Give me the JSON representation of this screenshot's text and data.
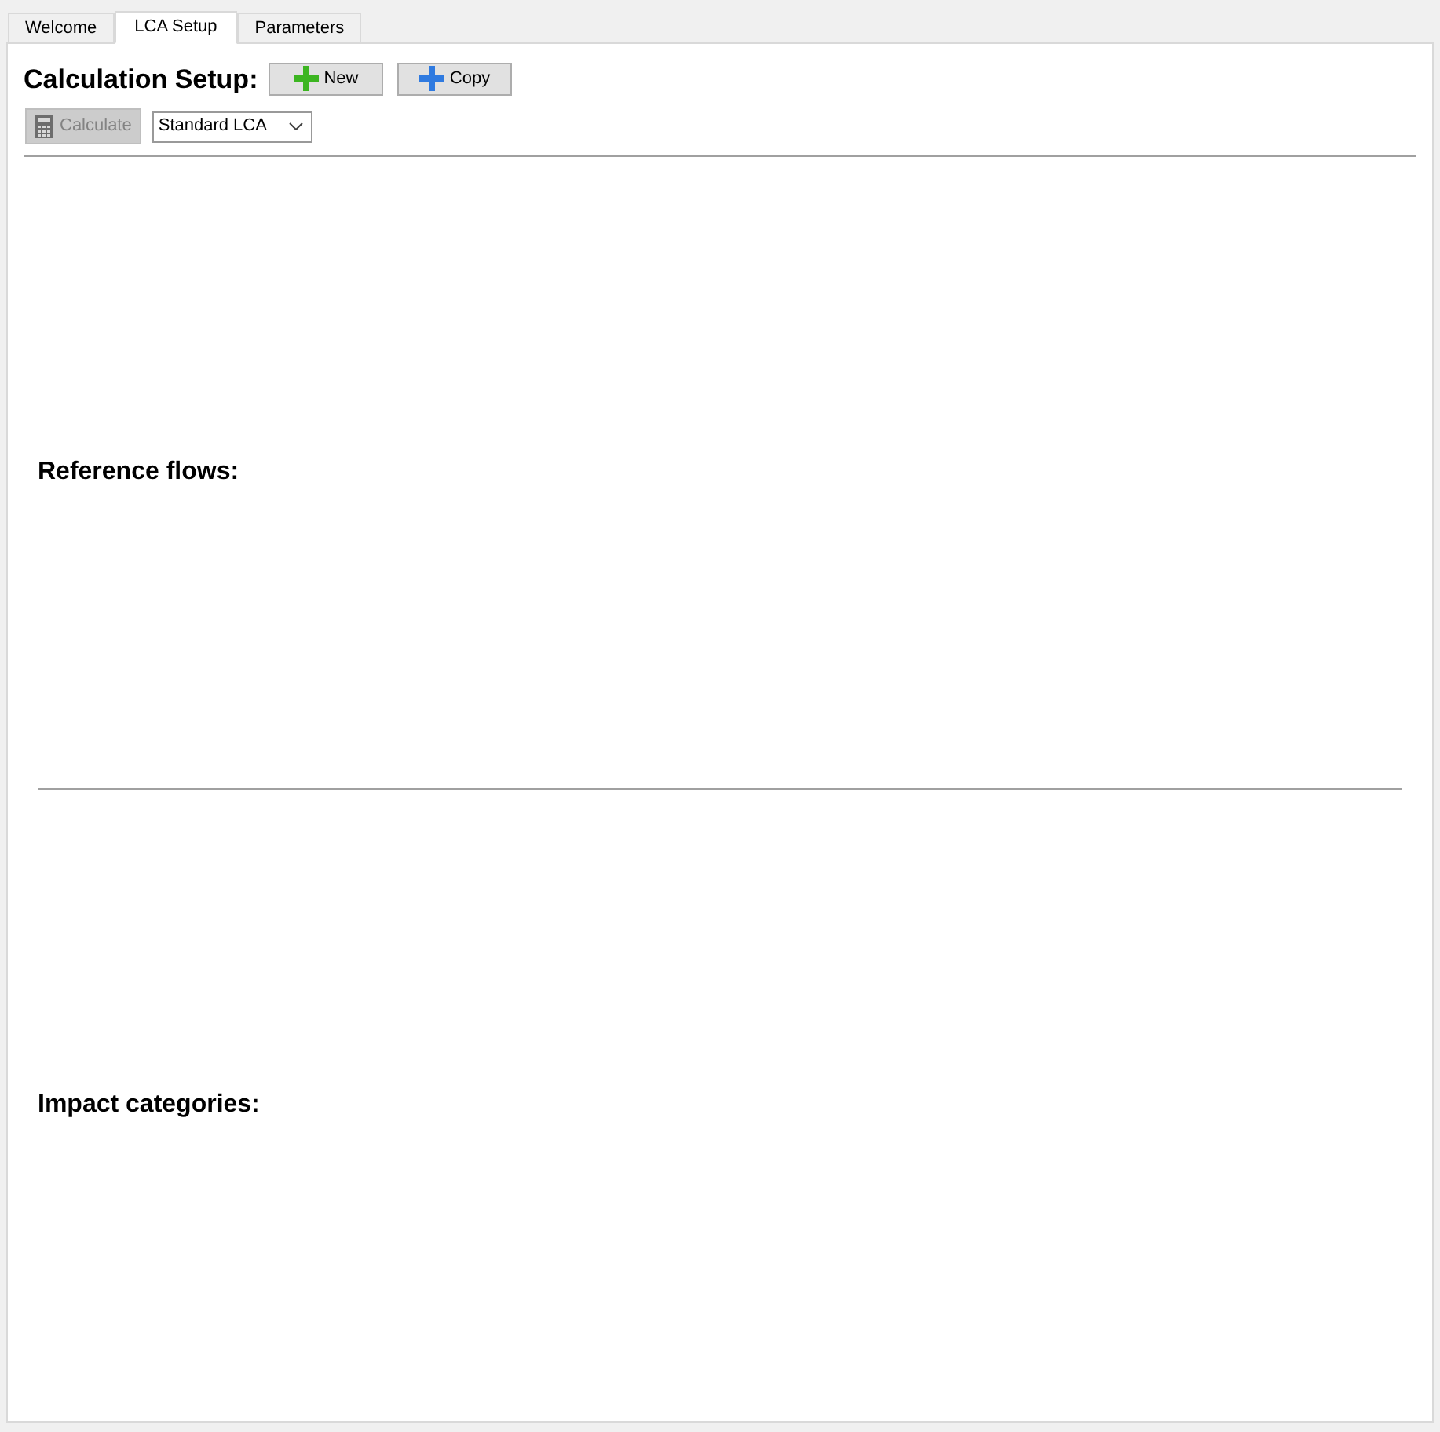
{
  "tabs": [
    {
      "label": "Welcome",
      "selected": false
    },
    {
      "label": "LCA Setup",
      "selected": true
    },
    {
      "label": "Parameters",
      "selected": false
    }
  ],
  "calculation_setup": {
    "title": "Calculation Setup:",
    "buttons": [
      {
        "label": "New",
        "kind": "new"
      },
      {
        "label": "Copy",
        "kind": "copy"
      }
    ],
    "calculate_button": {
      "label": "Calculate",
      "disabled": true
    },
    "calculation_type": {
      "value": "Standard LCA"
    }
  },
  "sections": [
    {
      "title": "Reference flows:"
    },
    {
      "title": "Impact categories:"
    }
  ]
}
